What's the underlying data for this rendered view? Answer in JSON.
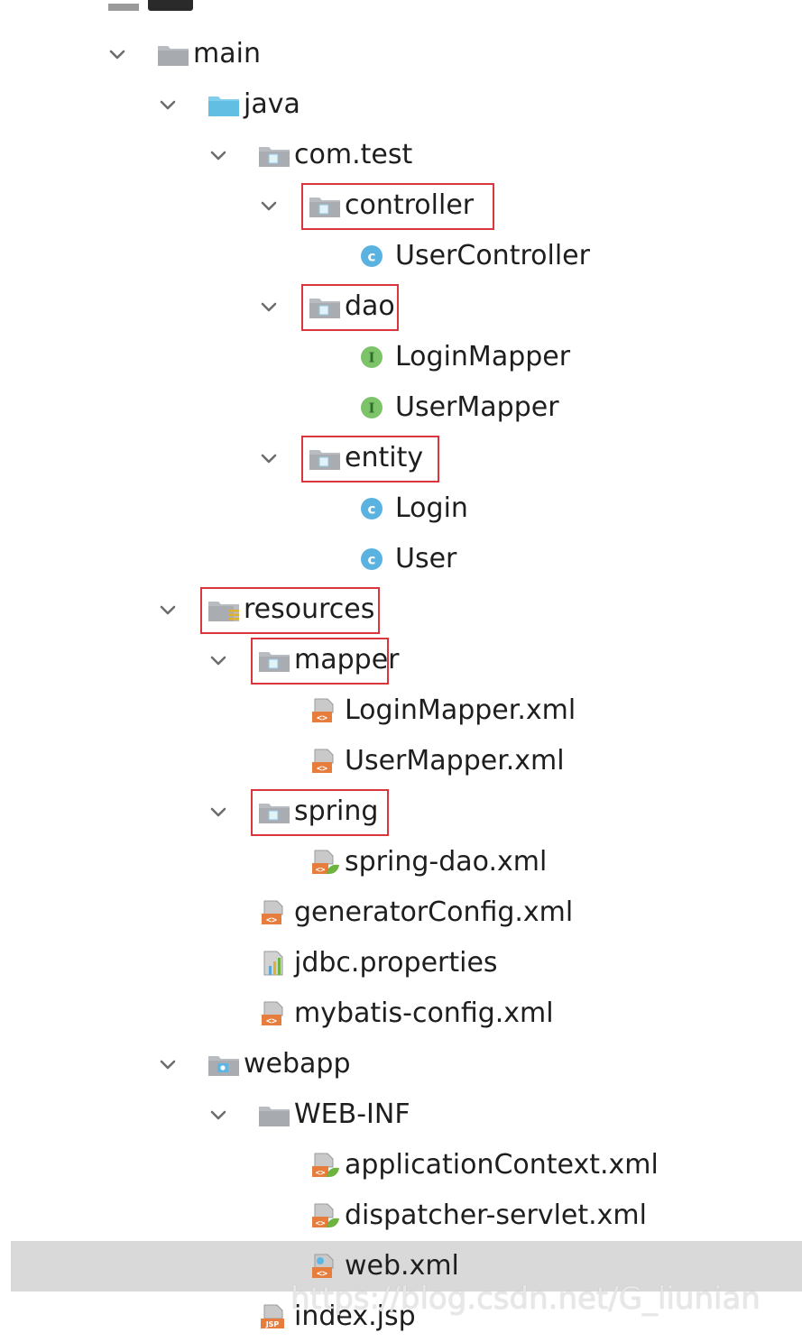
{
  "tree": [
    {
      "label": "main",
      "level": 0,
      "icon": "folder-gray",
      "expanded": true
    },
    {
      "label": "java",
      "level": 1,
      "icon": "folder-blue",
      "expanded": true
    },
    {
      "label": "com.test",
      "level": 2,
      "icon": "package-folder",
      "expanded": true
    },
    {
      "label": "controller",
      "level": 3,
      "icon": "package-folder",
      "expanded": true,
      "highlighted": true
    },
    {
      "label": "UserController",
      "level": 4,
      "icon": "class-c"
    },
    {
      "label": "dao",
      "level": 3,
      "icon": "package-folder",
      "expanded": true,
      "highlighted": true
    },
    {
      "label": "LoginMapper",
      "level": 4,
      "icon": "interface-i"
    },
    {
      "label": "UserMapper",
      "level": 4,
      "icon": "interface-i"
    },
    {
      "label": "entity",
      "level": 3,
      "icon": "package-folder",
      "expanded": true,
      "highlighted": true
    },
    {
      "label": "Login",
      "level": 4,
      "icon": "class-c"
    },
    {
      "label": "User",
      "level": 4,
      "icon": "class-c"
    },
    {
      "label": "resources",
      "level": 1,
      "icon": "resources-folder",
      "expanded": true,
      "highlighted": true
    },
    {
      "label": "mapper",
      "level": 2,
      "icon": "package-folder",
      "expanded": true,
      "highlighted": true
    },
    {
      "label": "LoginMapper.xml",
      "level": 3,
      "icon": "xml-file"
    },
    {
      "label": "UserMapper.xml",
      "level": 3,
      "icon": "xml-file"
    },
    {
      "label": "spring",
      "level": 2,
      "icon": "package-folder",
      "expanded": true,
      "highlighted": true
    },
    {
      "label": "spring-dao.xml",
      "level": 3,
      "icon": "spring-xml-file"
    },
    {
      "label": "generatorConfig.xml",
      "level": 2,
      "icon": "xml-file"
    },
    {
      "label": "jdbc.properties",
      "level": 2,
      "icon": "properties-file"
    },
    {
      "label": "mybatis-config.xml",
      "level": 2,
      "icon": "xml-file"
    },
    {
      "label": "webapp",
      "level": 1,
      "icon": "web-folder",
      "expanded": true
    },
    {
      "label": "WEB-INF",
      "level": 2,
      "icon": "folder-gray",
      "expanded": true
    },
    {
      "label": "applicationContext.xml",
      "level": 3,
      "icon": "spring-xml-file"
    },
    {
      "label": "dispatcher-servlet.xml",
      "level": 3,
      "icon": "spring-xml-file"
    },
    {
      "label": "web.xml",
      "level": 3,
      "icon": "web-xml-file",
      "selected": true
    },
    {
      "label": "index.jsp",
      "level": 2,
      "icon": "jsp-file"
    }
  ],
  "watermark": "https://blog.csdn.net/G_liunian",
  "colors": {
    "highlight_box": "#d9363e",
    "selection": "#d9d9d9",
    "class_icon": "#5ab2e0",
    "interface_icon": "#7cc36a",
    "folder": "#b4b8bc",
    "source_folder": "#6ec6e6"
  }
}
